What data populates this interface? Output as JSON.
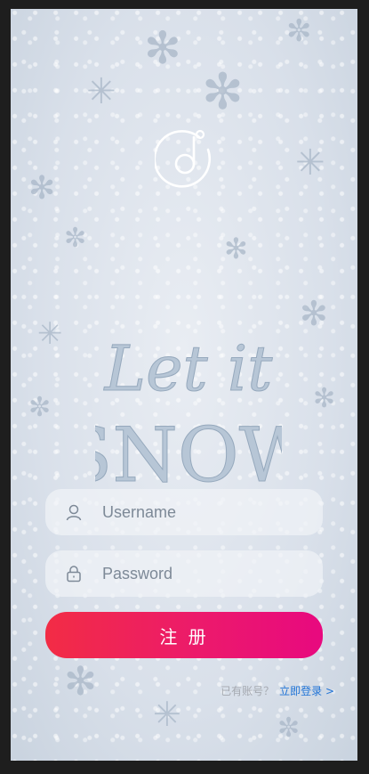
{
  "app": {
    "background_theme": "snow"
  },
  "hero": {
    "art_text_line1": "Let it",
    "art_text_line2": "SNOW"
  },
  "logo": {
    "icon": "music-note-circle-icon"
  },
  "form": {
    "username": {
      "placeholder": "Username",
      "icon": "user-icon"
    },
    "password": {
      "placeholder": "Password",
      "icon": "lock-icon"
    },
    "submit_label": "注 册"
  },
  "footer": {
    "question": "已有账号？",
    "login_link": "立即登录 >"
  },
  "colors": {
    "button_start": "#f22c45",
    "button_end": "#e8097f",
    "link": "#1f73d6"
  }
}
